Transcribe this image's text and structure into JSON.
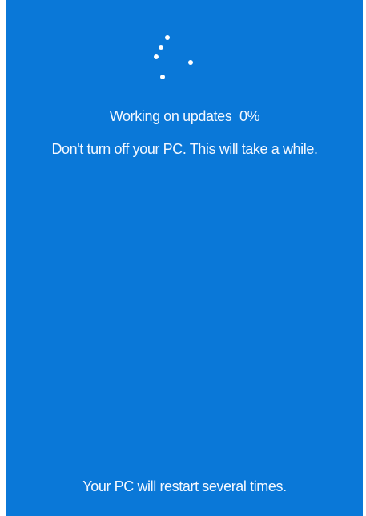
{
  "update_screen": {
    "progress_label": "Working on updates",
    "progress_percent": "0%",
    "warning": "Don't turn off your PC. This will take a while.",
    "footer": "Your PC will restart several times."
  },
  "icons": {
    "spinner": "loading-dots-icon"
  },
  "colors": {
    "background": "#0a78d8",
    "text": "#ffffff"
  }
}
